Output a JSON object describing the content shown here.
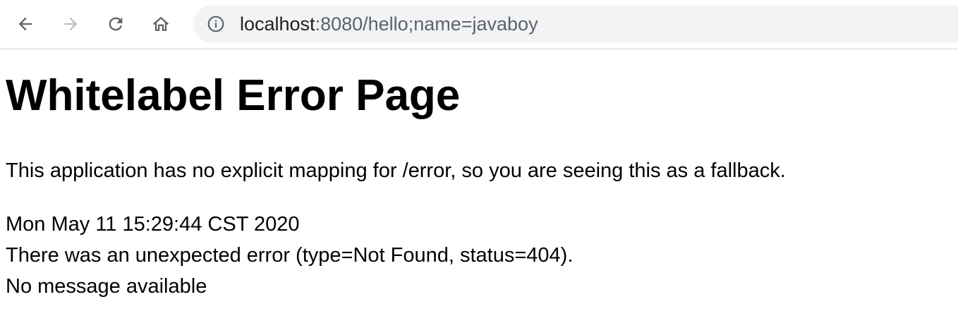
{
  "browser": {
    "url_host": "localhost",
    "url_rest": ":8080/hello;name=javaboy",
    "icons": {
      "back": "arrow-left-icon",
      "forward": "arrow-right-icon",
      "reload": "reload-icon",
      "home": "home-icon",
      "info": "info-icon"
    },
    "colors": {
      "omnibox_bg": "#f1f3f4",
      "icon_active": "#5f6368",
      "icon_disabled": "#bdc1c6"
    }
  },
  "page": {
    "title": "Whitelabel Error Page",
    "fallback_text": "This application has no explicit mapping for /error, so you are seeing this as a fallback.",
    "timestamp": "Mon May 11 15:29:44 CST 2020",
    "error_text": "There was an unexpected error (type=Not Found, status=404).",
    "message": "No message available"
  }
}
